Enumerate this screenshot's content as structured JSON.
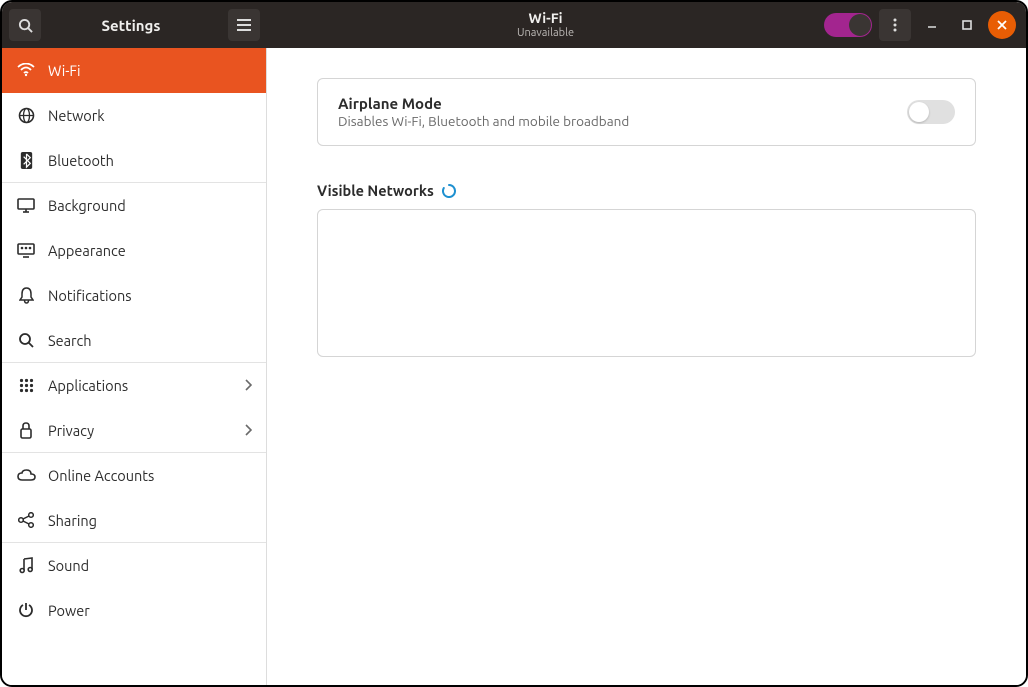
{
  "titlebar": {
    "left_title": "Settings",
    "main_title": "Wi-Fi",
    "subtitle": "Unavailable"
  },
  "sidebar": {
    "items": [
      {
        "label": "Wi-Fi",
        "active": true
      },
      {
        "label": "Network"
      },
      {
        "label": "Bluetooth"
      },
      {
        "label": "Background"
      },
      {
        "label": "Appearance"
      },
      {
        "label": "Notifications"
      },
      {
        "label": "Search"
      },
      {
        "label": "Applications",
        "chevron": true
      },
      {
        "label": "Privacy",
        "chevron": true
      },
      {
        "label": "Online Accounts"
      },
      {
        "label": "Sharing"
      },
      {
        "label": "Sound"
      },
      {
        "label": "Power"
      }
    ]
  },
  "content": {
    "airplane": {
      "title": "Airplane Mode",
      "subtitle": "Disables Wi-Fi, Bluetooth and mobile broadband",
      "enabled": false
    },
    "visible_networks_label": "Visible Networks"
  }
}
